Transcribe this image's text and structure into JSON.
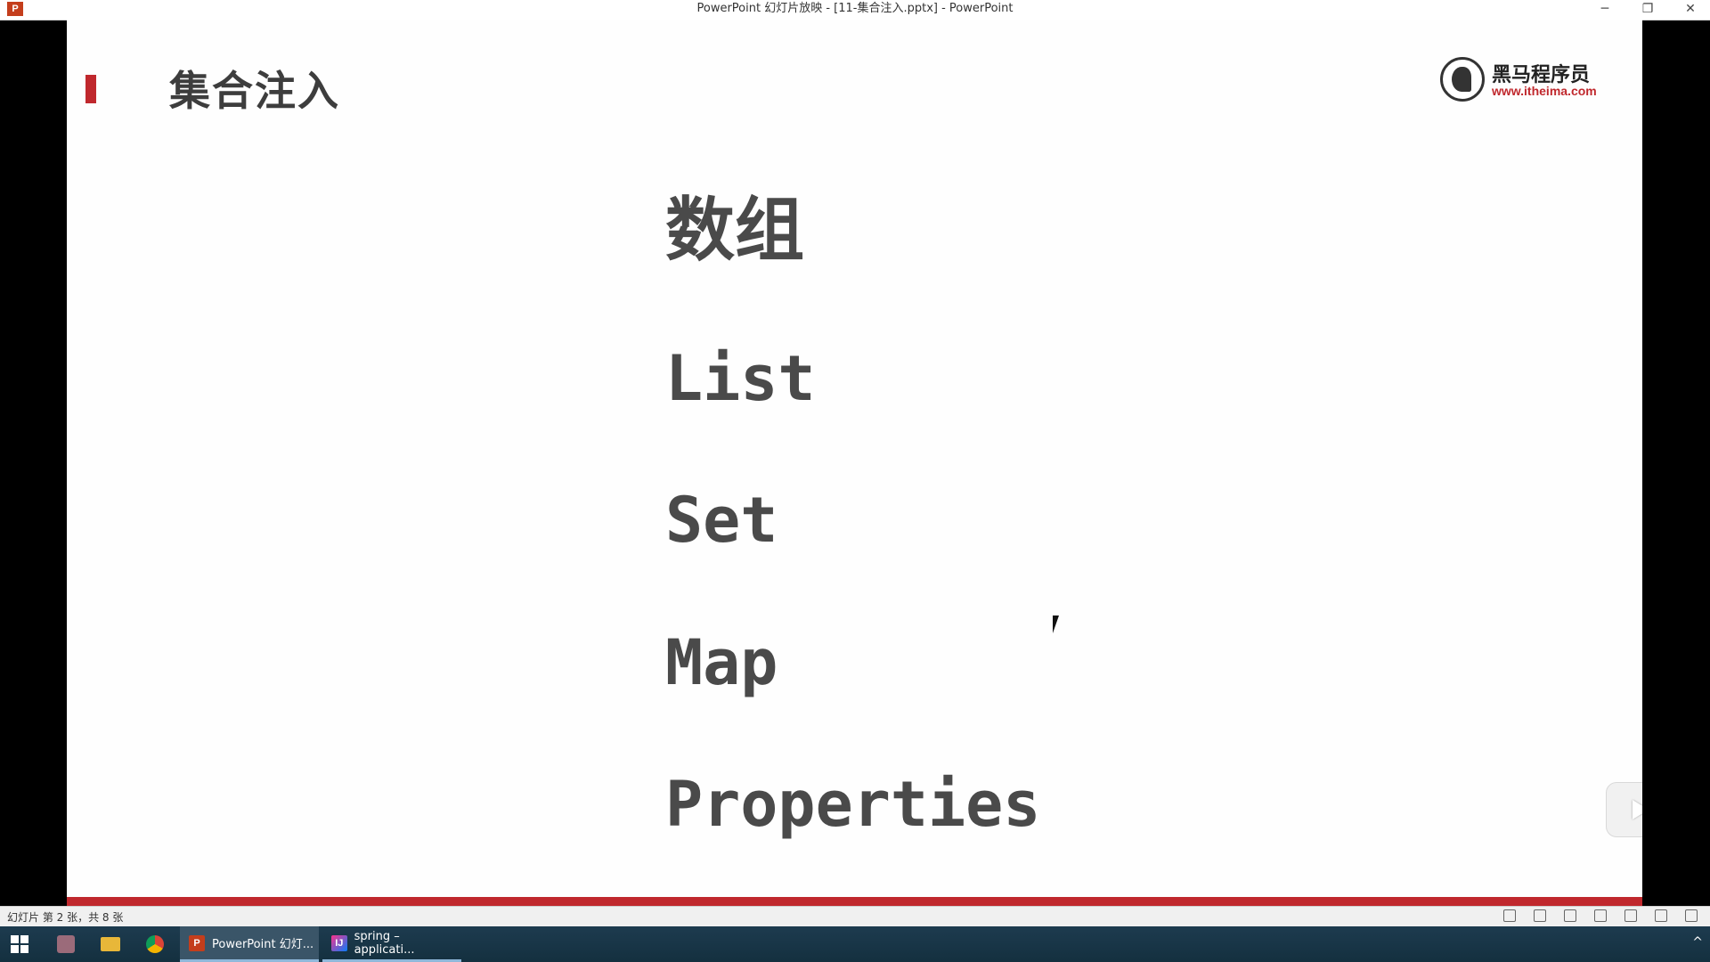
{
  "window": {
    "app_icon": "powerpoint-icon",
    "title": "PowerPoint 幻灯片放映 - [11-集合注入.pptx] - PowerPoint",
    "minimize": "─",
    "restore": "❐",
    "close": "✕"
  },
  "slide": {
    "title": "集合注入",
    "logo": {
      "name": "黑马程序员",
      "url": "www.itheima.com"
    },
    "items": [
      "数组",
      "List",
      "Set",
      "Map",
      "Properties"
    ],
    "accent_color": "#c0282d"
  },
  "statusbar": {
    "text": "幻灯片 第 2 张，共 8 张"
  },
  "taskbar": {
    "tasks": [
      {
        "icon": "powerpoint-icon",
        "label": "PowerPoint 幻灯..."
      },
      {
        "icon": "intellij-icon",
        "label": "spring – applicati..."
      }
    ]
  }
}
